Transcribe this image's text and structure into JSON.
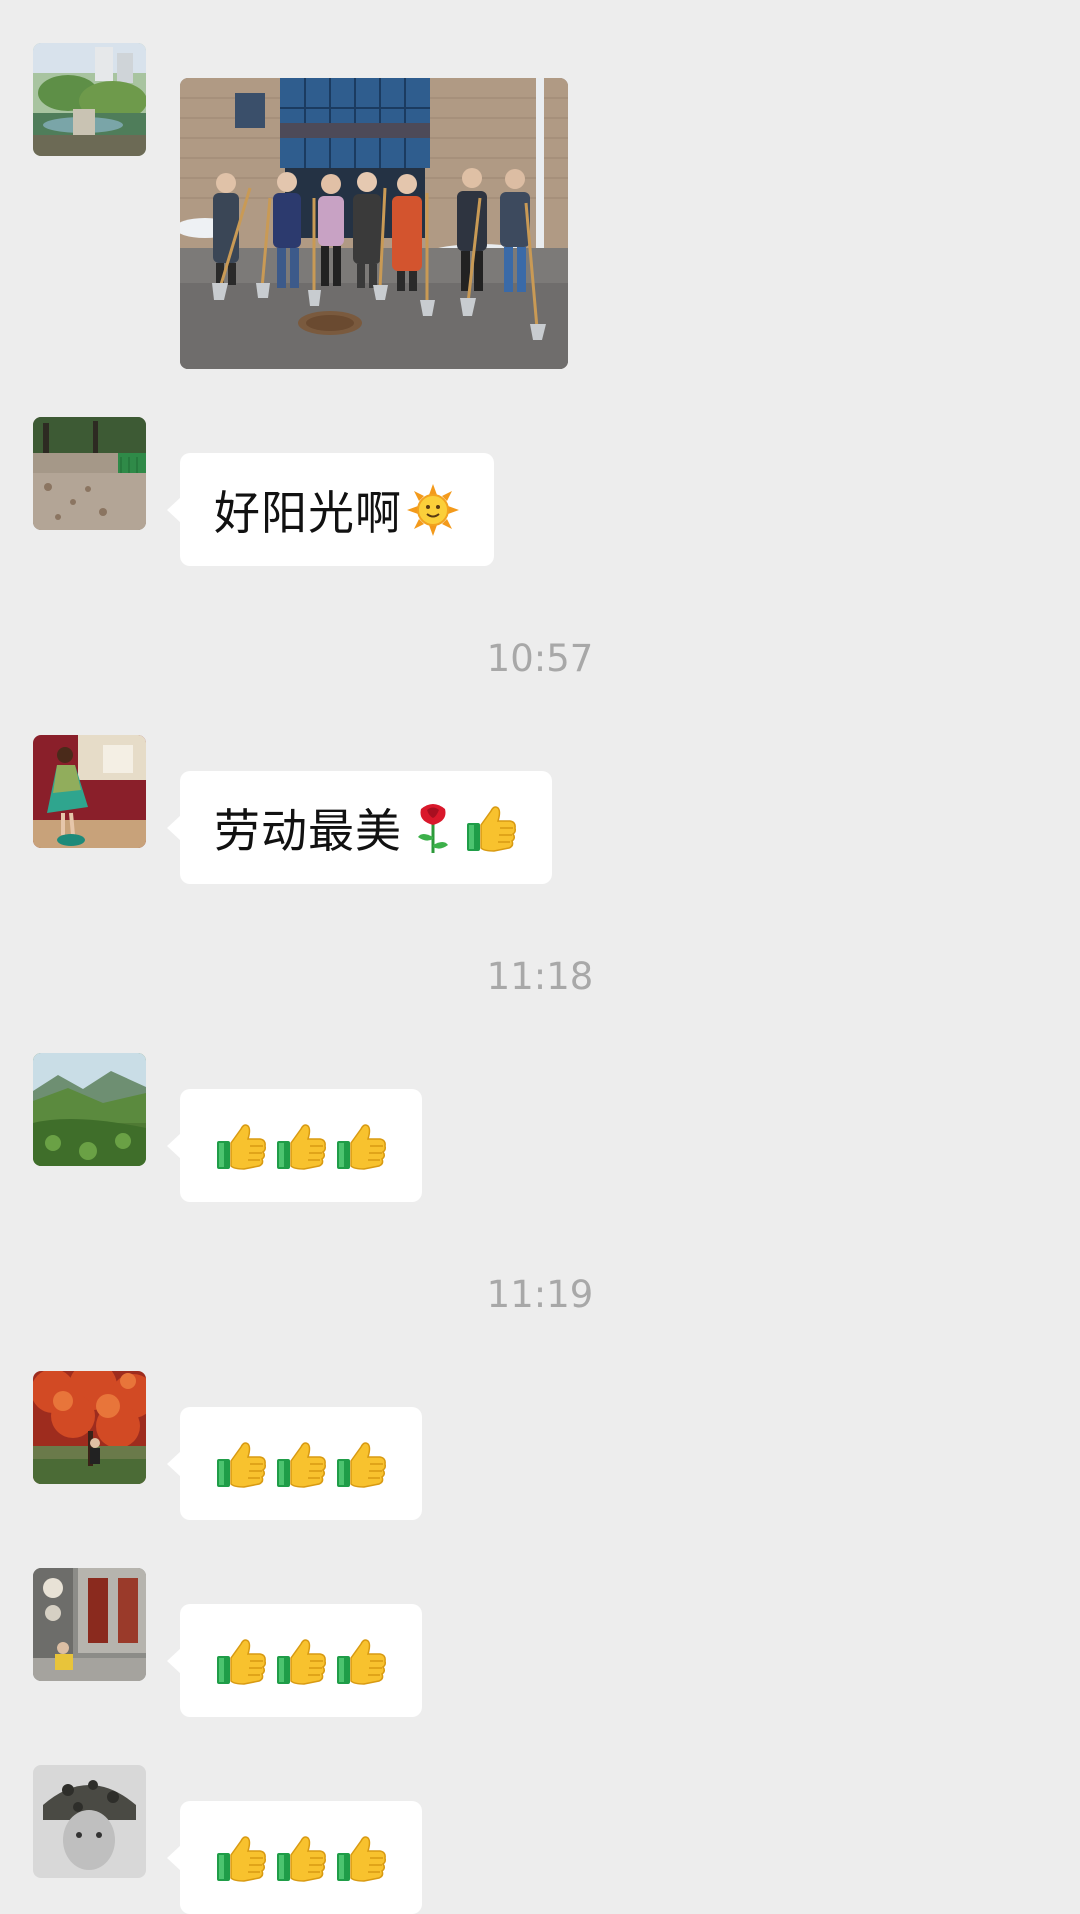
{
  "messages": [
    {
      "type": "image",
      "avatar": "garden-avatar",
      "image": "group-photo-with-shovels"
    },
    {
      "type": "text",
      "avatar": "leaves-path-avatar",
      "text": "好阳光啊",
      "emoji": [
        "sun-emoji"
      ]
    },
    {
      "type": "timestamp",
      "text": "10:57"
    },
    {
      "type": "text",
      "avatar": "dancer-avatar",
      "text": "劳动最美",
      "emoji": [
        "rose-emoji",
        "thumbs-up-emoji"
      ]
    },
    {
      "type": "timestamp",
      "text": "11:18"
    },
    {
      "type": "text",
      "avatar": "mountain-avatar",
      "text": "",
      "emoji": [
        "thumbs-up-emoji",
        "thumbs-up-emoji",
        "thumbs-up-emoji"
      ]
    },
    {
      "type": "timestamp",
      "text": "11:19"
    },
    {
      "type": "text",
      "avatar": "autumn-tree-avatar",
      "text": "",
      "emoji": [
        "thumbs-up-emoji",
        "thumbs-up-emoji",
        "thumbs-up-emoji"
      ]
    },
    {
      "type": "text",
      "avatar": "street-avatar",
      "text": "",
      "emoji": [
        "thumbs-up-emoji",
        "thumbs-up-emoji",
        "thumbs-up-emoji"
      ]
    },
    {
      "type": "text",
      "avatar": "camo-hat-avatar",
      "text": "",
      "emoji": [
        "thumbs-up-emoji",
        "thumbs-up-emoji",
        "thumbs-up-emoji"
      ]
    }
  ],
  "timestamps": {
    "t1": "10:57",
    "t2": "11:18",
    "t3": "11:19"
  },
  "texts": {
    "m2": "好阳光啊",
    "m4": "劳动最美"
  },
  "colors": {
    "background": "#ededed",
    "bubble": "#ffffff",
    "timestamp": "#a8a8a8"
  }
}
